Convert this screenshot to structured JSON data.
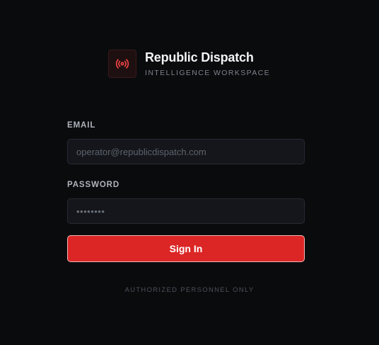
{
  "brand": {
    "logo_icon": "broadcast-icon",
    "title": "Republic Dispatch",
    "subtitle": "INTELLIGENCE WORKSPACE"
  },
  "form": {
    "email": {
      "label": "EMAIL",
      "value": "",
      "placeholder": "operator@republicdispatch.com"
    },
    "password": {
      "label": "PASSWORD",
      "value": "",
      "placeholder": "••••••••"
    },
    "submit_label": "Sign In"
  },
  "footer": {
    "notice": "AUTHORIZED PERSONNEL ONLY"
  },
  "colors": {
    "background": "#0a0b0d",
    "accent": "#dc2626",
    "input_bg": "#14161b",
    "logo_bg": "#1e0f10"
  }
}
